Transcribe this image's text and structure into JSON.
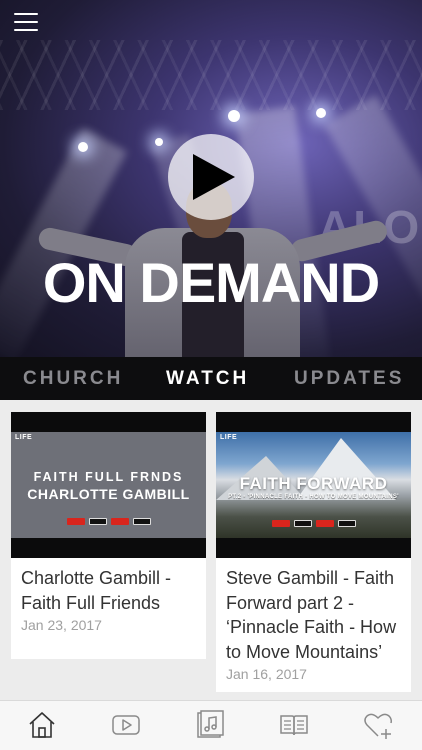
{
  "hero": {
    "title": "ON DEMAND",
    "stage_text": "ALOU"
  },
  "tabs": [
    {
      "label": "CHURCH",
      "active": false
    },
    {
      "label": "WATCH",
      "active": true
    },
    {
      "label": "UPDATES",
      "active": false
    }
  ],
  "cards": [
    {
      "thumb_brand": "LIFE",
      "thumb_line1": "FAITH FULL FRNDS",
      "thumb_line2": "CHARLOTTE GAMBILL",
      "title": "Charlotte Gambill - Faith Full Friends",
      "date": "Jan 23, 2017"
    },
    {
      "thumb_brand": "LIFE",
      "thumb_line1": "FAITH FORWARD",
      "thumb_line2": "PT.2 - 'PINNACLE FAITH - HOW TO MOVE MOUNTAINS'",
      "title": "Steve Gambill - Faith Forward part 2 - ‘Pinnacle Faith - How to Move Mountains’",
      "date": "Jan 16, 2017"
    }
  ],
  "bottom_nav": {
    "items": [
      "home-icon",
      "video-play-icon",
      "music-library-icon",
      "book-icon",
      "heart-plus-icon"
    ],
    "active": "home-icon",
    "active_color": "#333333",
    "inactive_color": "#8a8a8a"
  },
  "colors": {
    "tab_bar": "#0d0d0f",
    "tab_active": "#ffffff",
    "tab_inactive": "#8a8a8f",
    "badge_red": "#d9251d"
  }
}
